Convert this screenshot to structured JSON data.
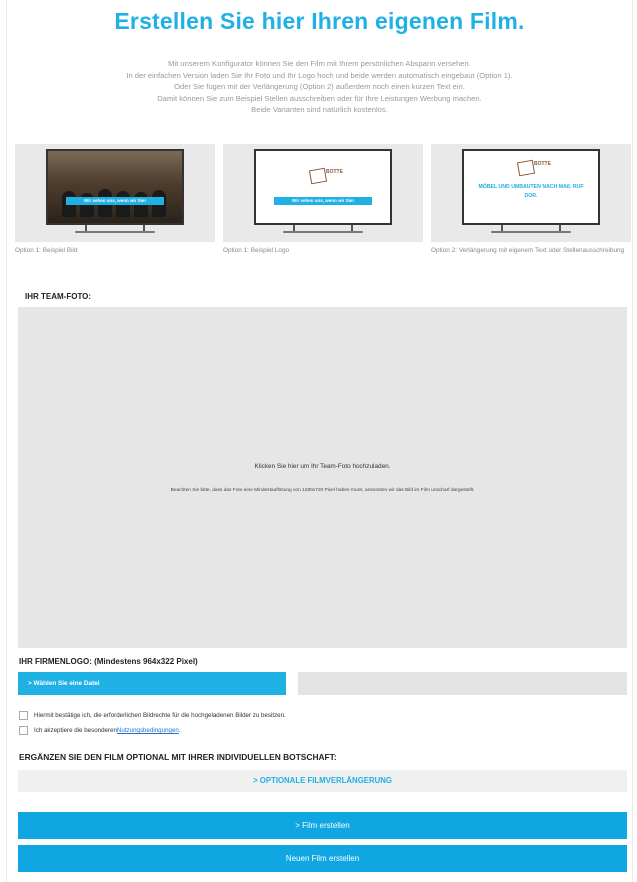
{
  "page": {
    "title": "Erstellen Sie hier Ihren eigenen Film.",
    "intro_lines": [
      "Mit unserem Konfigurator können Sie den Film mit Ihrem persönlichen Abspann versehen.",
      "In der einfachen Version laden Sie Ihr Foto und Ihr Logo hoch und beide werden automatisch eingebaut (Option 1).",
      "Oder Sie fügen mit der Verlängerung (Option 2) außerdem noch einen kurzen Text ein.",
      "Damit können Sie zum Beispiel Stellen ausschreiben oder für Ihre Leistungen Werbung machen.",
      "Beide Varianten sind natürlich kostenlos."
    ]
  },
  "examples": [
    {
      "caption": "Option 1: Beispiel Bild",
      "banner": "Wir sehen uns, wenn wir Sie!"
    },
    {
      "caption": "Option 1: Beispiel Logo",
      "banner": "Wir sehen uns, wenn wir Sie!",
      "logo": "BOTTE"
    },
    {
      "caption": "Option 2: Verlängerung mit eigenem Text oder Stellenausschreibung",
      "logo": "BOTTE",
      "blue_text": "MÖBEL UND UMBAUTEN NACH MAß. RUF DOR."
    }
  ],
  "team_photo": {
    "label": "IHR TEAM-FOTO:",
    "upload_text": "Klicken Sie hier um Ihr Team-Foto hochzuladen.",
    "note": "Beachten Sie bitte, dass das Foto eine Mindestauflösung von 1280x720 Pixel haben muss, ansonsten wir das Bild im Film unscharf dargestellt."
  },
  "logo_upload": {
    "label": "IHR FIRMENLOGO: (Mindestens 964x322 Pixel)",
    "button": "> Wählen Sie eine Datei"
  },
  "consents": {
    "rights": "Hiermit bestätige ich, die erforderlichen Bildrechte für die hochgeladenen Bilder zu besitzen.",
    "terms_prefix": "Ich akzeptiere die besonderen ",
    "terms_link": "Nutzungsbedingungen",
    "terms_suffix": "."
  },
  "extension": {
    "label": "ERGÄNZEN SIE DEN FILM OPTIONAL MIT IHRER INDIVIDUELLEN BOTSCHAFT:",
    "button": "> OPTIONALE FILMVERLÄNGERUNG"
  },
  "actions": {
    "create": "> Film erstellen",
    "new": "Neuen Film erstellen"
  },
  "colors": {
    "accent": "#1fb0e4",
    "button": "#0fa6e1",
    "panel": "#e6e6e6"
  }
}
